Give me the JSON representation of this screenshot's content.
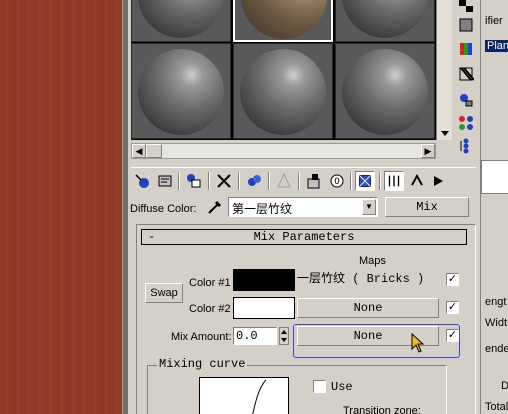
{
  "slots": {
    "sphere_count": 6,
    "selected_index": 1
  },
  "toolbar": {
    "icons": [
      "get-material-icon",
      "put-to-scene-icon",
      "assign-material-icon",
      "reset-map-icon",
      "make-copy-icon",
      "make-unique-icon",
      "put-to-library-icon",
      "material-id-icon",
      "show-map-icon",
      "show-end-result-icon",
      "go-to-parent-icon",
      "go-forward-icon"
    ]
  },
  "diffuse": {
    "label": "Diffuse Color:",
    "map_name": "第一层竹纹",
    "type_label": "Mix"
  },
  "mix_parameters": {
    "title": "Mix Parameters",
    "collapse": "-",
    "maps_header": "Maps",
    "swap_label": "Swap",
    "color1_label": "Color #1",
    "color1_value": "#000000",
    "color1_map": "一层竹纹  ( Bricks )",
    "color1_enabled": true,
    "color2_label": "Color #2",
    "color2_value": "#ffffff",
    "color2_map": "None",
    "color2_enabled": true,
    "mix_amount_label": "Mix Amount:",
    "mix_amount_value": "0.0",
    "mix_map": "None",
    "mix_map_enabled": true
  },
  "mixing_curve": {
    "title": "Mixing curve",
    "use_label": "Use",
    "use_checked": false,
    "transition_label": "Transition zone:"
  },
  "right_panel": {
    "items": [
      "ifier",
      "Plan",
      "engt",
      "Widt",
      "ende",
      "D",
      "Total"
    ]
  },
  "colors": {
    "highlight_border": "#3b48c8",
    "panel_bg": "#d4d0c8"
  }
}
